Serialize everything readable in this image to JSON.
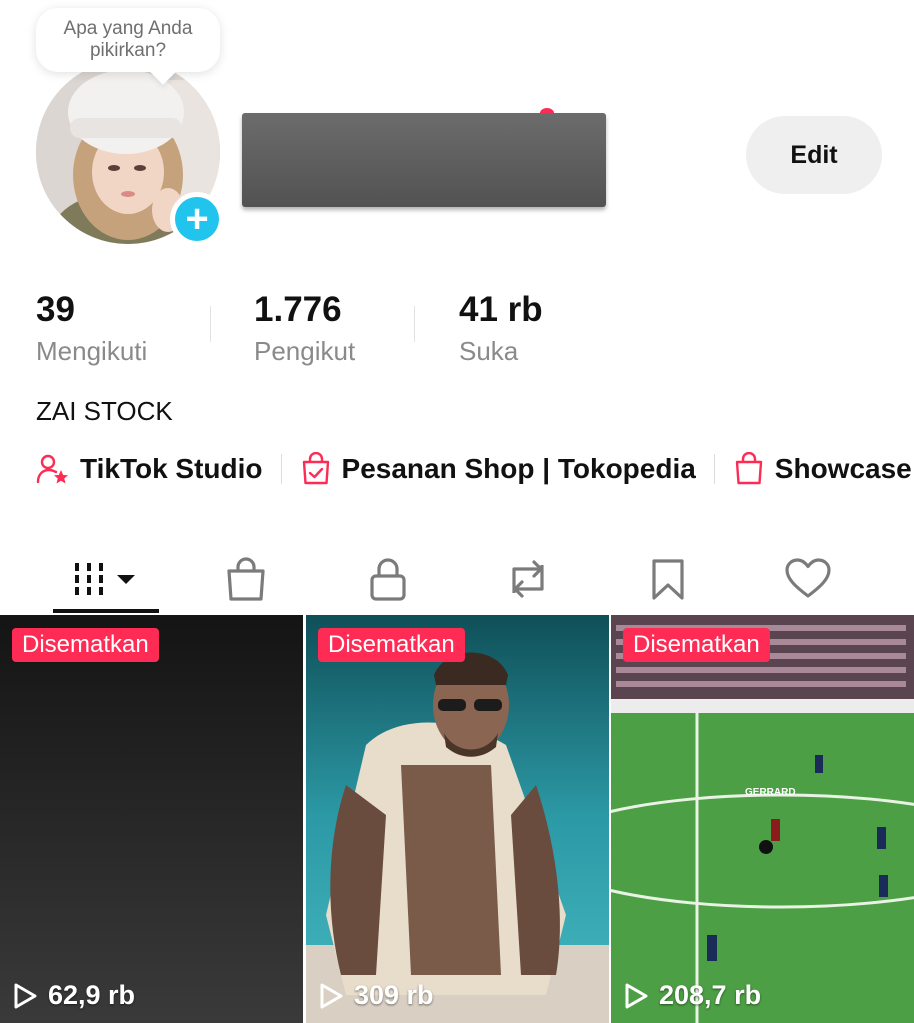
{
  "profile": {
    "note_bubble": "Apa yang Anda pikirkan?",
    "edit_label": "Edit",
    "bio": "ZAI STOCK"
  },
  "stats": [
    {
      "value": "39",
      "label": "Mengikuti"
    },
    {
      "value": "1.776",
      "label": "Pengikut"
    },
    {
      "value": "41 rb",
      "label": "Suka"
    }
  ],
  "links": [
    {
      "label": "TikTok Studio",
      "icon": "person-star-icon"
    },
    {
      "label": "Pesanan Shop | Tokopedia",
      "icon": "shopping-bag-check-icon"
    },
    {
      "label": "Showcase",
      "icon": "shopping-bag-icon"
    }
  ],
  "tabs": [
    {
      "name": "videos",
      "icon": "grid-bars-icon",
      "active": true
    },
    {
      "name": "shop",
      "icon": "shopping-bag-icon"
    },
    {
      "name": "private",
      "icon": "lock-icon"
    },
    {
      "name": "reposts",
      "icon": "repost-icon"
    },
    {
      "name": "favorites",
      "icon": "bookmark-icon"
    },
    {
      "name": "liked",
      "icon": "heart-icon"
    }
  ],
  "videos": [
    {
      "badge": "Disematkan",
      "views": "62,9 rb"
    },
    {
      "badge": "Disematkan",
      "views": "309 rb"
    },
    {
      "badge": "Disematkan",
      "views": "208,7 rb",
      "caption_in_frame": "GERRARD"
    }
  ],
  "colors": {
    "accent": "#fe2c55",
    "add_button": "#20c4ec",
    "muted_text": "#8a8a8a"
  }
}
